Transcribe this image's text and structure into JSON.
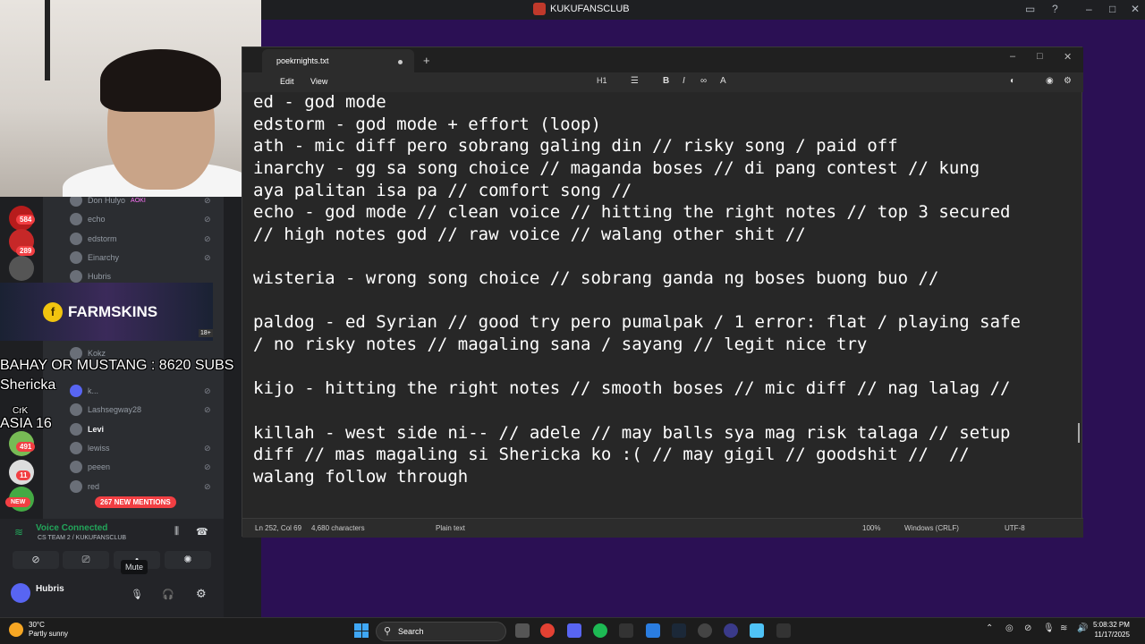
{
  "discord": {
    "window_title": "KUKUFANSCLUB",
    "members": [
      {
        "name": "Don Hulyo",
        "tag": "AOKI"
      },
      {
        "name": "echo"
      },
      {
        "name": "edstorm"
      },
      {
        "name": "Einarchy"
      },
      {
        "name": "Hubris"
      },
      {
        "name": "Kokz"
      },
      {
        "name": "k..."
      },
      {
        "name": "Lashsegway28"
      },
      {
        "name": "Levi"
      },
      {
        "name": "lewiss"
      },
      {
        "name": "peeen"
      },
      {
        "name": "red"
      }
    ],
    "server_badges": [
      "584",
      "289",
      "491",
      "11"
    ],
    "new_label": "NEW",
    "mentions_label": "267 NEW MENTIONS",
    "voice": {
      "status": "Voice Connected",
      "channel": "CS TEAM 2 / KUKUFANSCLUB",
      "tooltip": "Mute"
    },
    "user": {
      "name": "Hubris"
    }
  },
  "ad": {
    "brand": "FARMSKINS",
    "age": "18+"
  },
  "overlay": {
    "line1": "BAHAY OR MUSTANG : 8620 SUBS",
    "line2": "Shericka",
    "line3": "ASIA 16",
    "label_crk": "CrK"
  },
  "notepad": {
    "tab_name": "poekrnights.txt",
    "menu": [
      "Edit",
      "View"
    ],
    "heading_btn": "H1",
    "lines": [
      "ed - god mode",
      "edstorm - god mode + effort (loop)",
      "ath - mic diff pero sobrang galing din // risky song / paid off",
      "inarchy - gg sa song choice // maganda boses // di pang contest // kung",
      "aya palitan isa pa // comfort song //",
      "echo - god mode // clean voice // hitting the right notes // top 3 secured",
      "// high notes god // raw voice // walang other shit //",
      "",
      "wisteria - wrong song choice // sobrang ganda ng boses buong buo //",
      "",
      "paldog - ed Syrian // good try pero pumalpak / 1 error: flat / playing safe",
      "/ no risky notes // magaling sana / sayang // legit nice try",
      "",
      "kijo - hitting the right notes // smooth boses // mic diff // nag lalag //",
      "",
      "killah - west side ni-- // adele // may balls sya mag risk talaga // setup",
      "diff // mas magaling si Shericka ko :( // may gigil // goodshit //  //",
      "walang follow through"
    ],
    "status": {
      "position": "Ln 252, Col 69",
      "chars": "4,680 characters",
      "format": "Plain text",
      "zoom": "100%",
      "line_ending": "Windows (CRLF)",
      "encoding": "UTF-8"
    }
  },
  "taskbar": {
    "temp": "30°C",
    "weather": "Partly sunny",
    "search": "Search",
    "time": "5:08:32 PM",
    "date": "11/17/2025"
  }
}
